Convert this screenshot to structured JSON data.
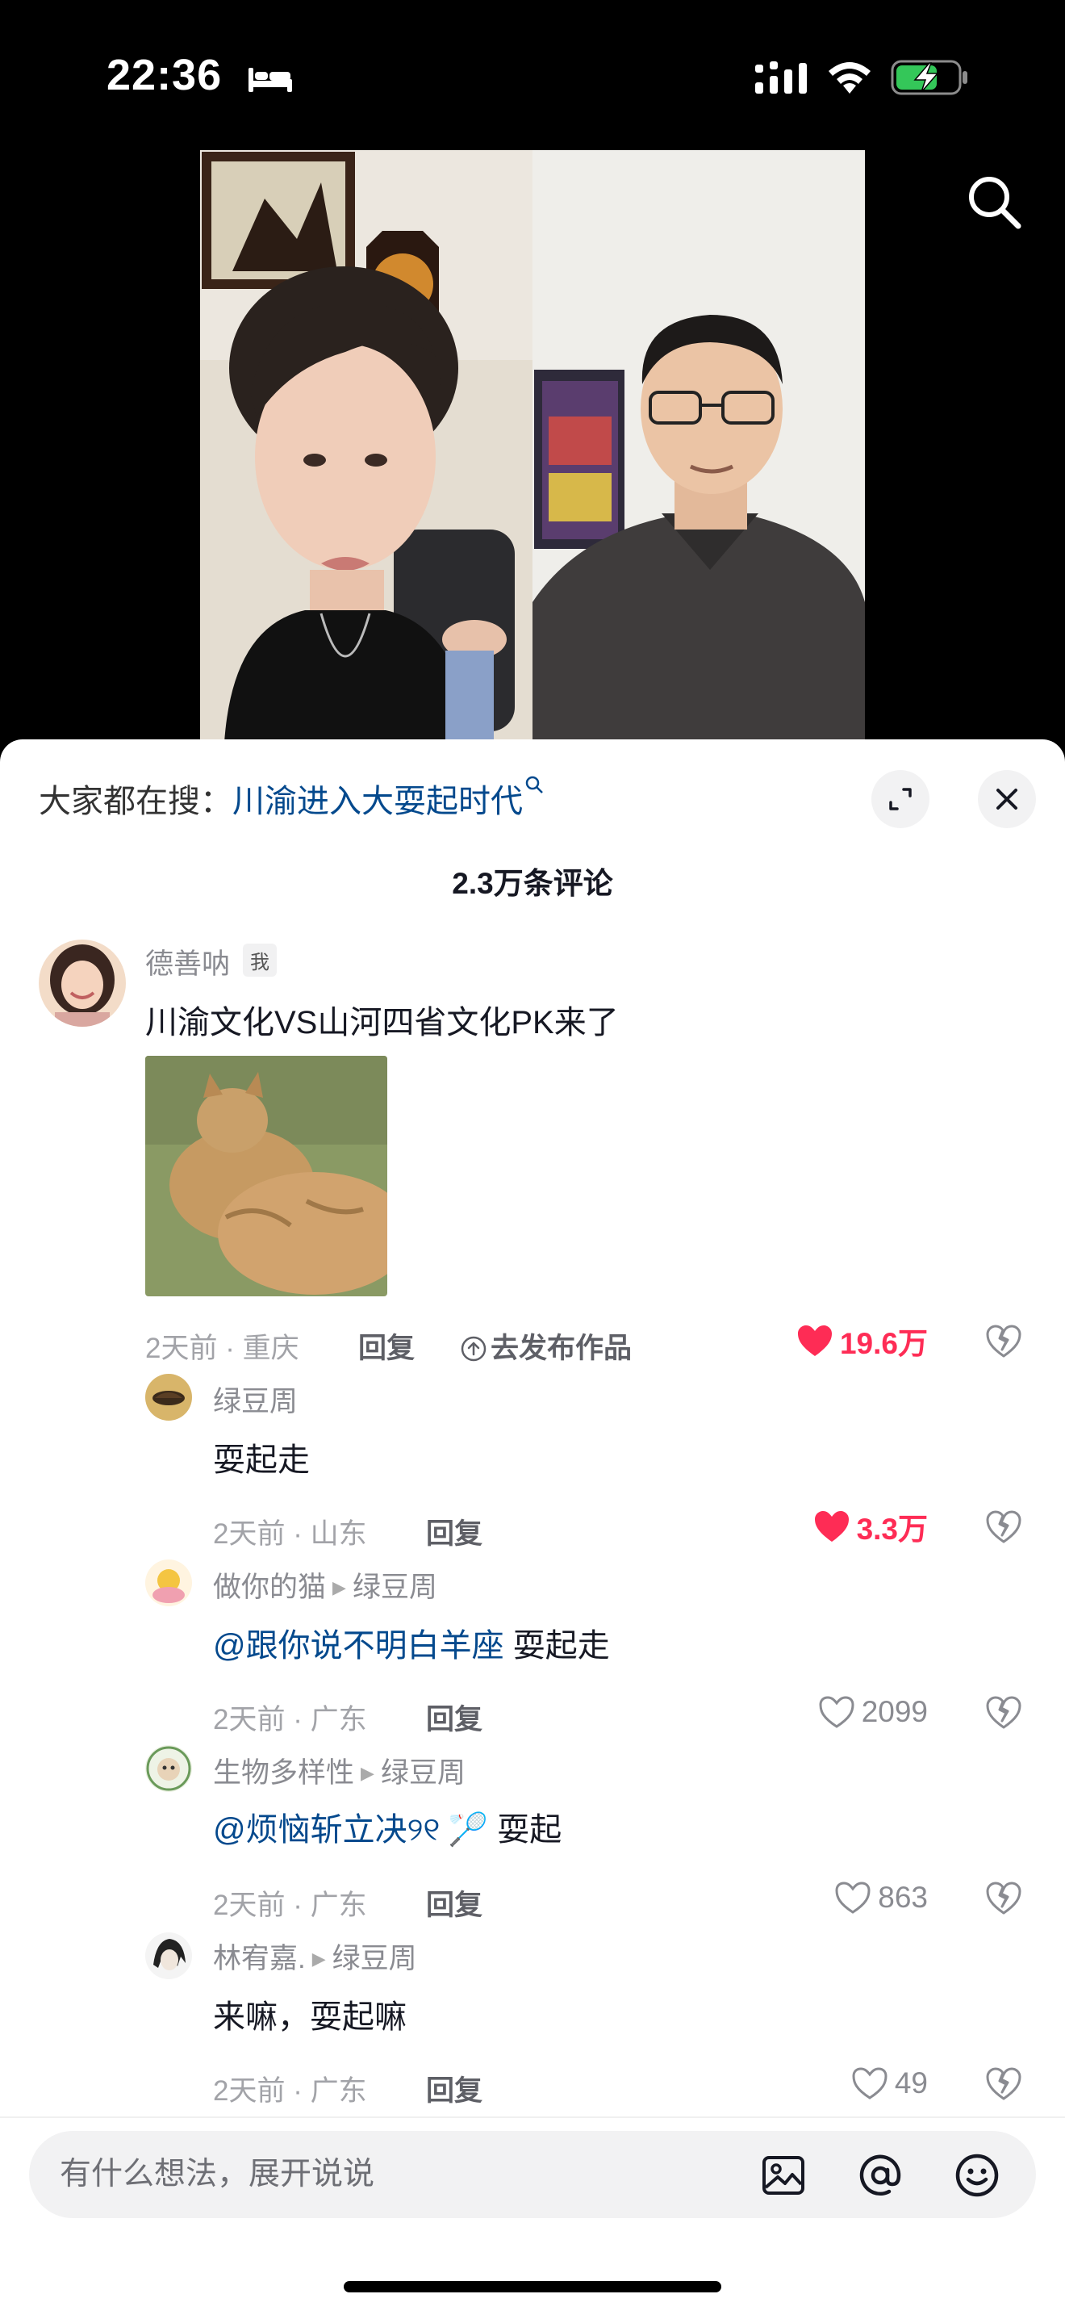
{
  "status_bar": {
    "time": "22:36"
  },
  "trend": {
    "prefix": "大家都在搜：",
    "query": "川渝进入大耍起时代"
  },
  "comment_count": "2.3万条评论",
  "comments": [
    {
      "user": "德善呐",
      "badge": "我",
      "text": "川渝文化VS山河四省文化PK来了",
      "time_loc": "2天前 · 重庆",
      "reply": "回复",
      "publish": "去发布作品",
      "likes": "19.6万",
      "liked": true,
      "has_image": true
    },
    {
      "user": "绿豆周",
      "text": "耍起走",
      "time_loc": "2天前 · 山东",
      "reply": "回复",
      "likes": "3.3万",
      "liked": true
    },
    {
      "user": "做你的猫",
      "reply_to": "绿豆周",
      "mention": "@跟你说不明白羊座",
      "text": " 耍起走",
      "time_loc": "2天前 · 广东",
      "reply": "回复",
      "likes": "2099",
      "liked": false
    },
    {
      "user": "生物多样性",
      "reply_to": "绿豆周",
      "mention": "@烦恼斩立决୨୧",
      "emoji": "🏸",
      "text": " 耍起",
      "time_loc": "2天前 · 广东",
      "reply": "回复",
      "likes": "863",
      "liked": false
    },
    {
      "user": "林宥嘉.",
      "reply_to": "绿豆周",
      "text": "来嘛，耍起嘛",
      "time_loc": "2天前 · 广东",
      "reply": "回复",
      "likes": "49",
      "liked": false
    }
  ],
  "input": {
    "placeholder": "有什么想法，展开说说"
  },
  "colors": {
    "like_red": "#fe2c55",
    "mention_blue": "#04498d",
    "battery_green": "#34c759"
  }
}
